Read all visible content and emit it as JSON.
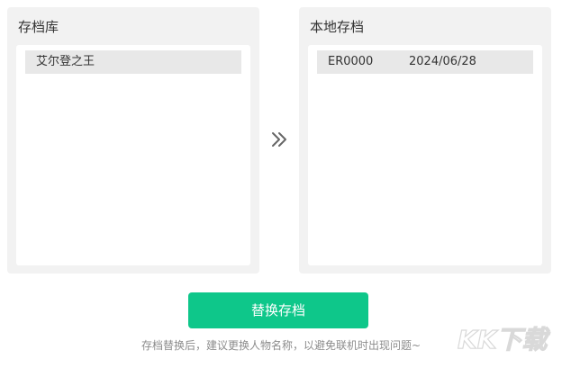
{
  "archive_library": {
    "title": "存档库",
    "items": [
      {
        "name": "艾尔登之王"
      }
    ]
  },
  "local_archive": {
    "title": "本地存档",
    "items": [
      {
        "name": "ER0000",
        "date": "2024/06/28"
      }
    ]
  },
  "transfer_icon": "double-chevron-right-icon",
  "replace_button": {
    "label": "替换存档",
    "color": "#0ec78a"
  },
  "hint": "存档替换后，建议更换人物名称，以避免联机时出现问题~",
  "watermark": {
    "text": "KK下载"
  }
}
